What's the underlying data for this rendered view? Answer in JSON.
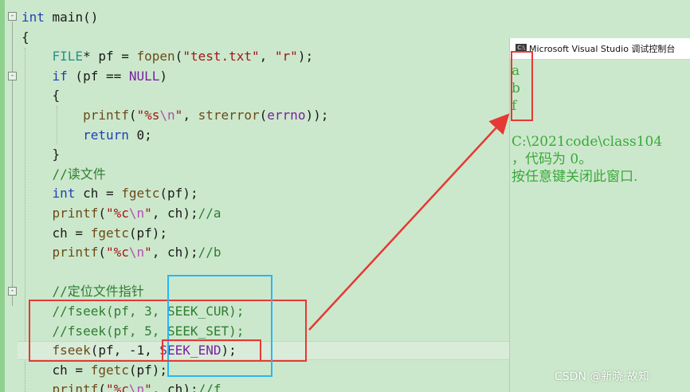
{
  "code_lines": [
    [
      {
        "t": "int",
        "c": "kw"
      },
      {
        "t": " main()"
      }
    ],
    [
      {
        "t": "{"
      }
    ],
    [
      {
        "t": "    "
      },
      {
        "t": "FILE",
        "c": "ty"
      },
      {
        "t": "* pf = "
      },
      {
        "t": "fopen",
        "c": "fn"
      },
      {
        "t": "("
      },
      {
        "t": "\"test.txt\"",
        "c": "str"
      },
      {
        "t": ", "
      },
      {
        "t": "\"r\"",
        "c": "str"
      },
      {
        "t": ");"
      }
    ],
    [
      {
        "t": "    "
      },
      {
        "t": "if",
        "c": "kw"
      },
      {
        "t": " (pf == "
      },
      {
        "t": "NULL",
        "c": "mac"
      },
      {
        "t": ")"
      }
    ],
    [
      {
        "t": "    {"
      }
    ],
    [
      {
        "t": "        "
      },
      {
        "t": "printf",
        "c": "fn"
      },
      {
        "t": "("
      },
      {
        "t": "\"%s",
        "c": "str"
      },
      {
        "t": "\\n",
        "c": "esc"
      },
      {
        "t": "\"",
        "c": "str"
      },
      {
        "t": ", "
      },
      {
        "t": "strerror",
        "c": "fn"
      },
      {
        "t": "("
      },
      {
        "t": "errno",
        "c": "mac"
      },
      {
        "t": "));"
      }
    ],
    [
      {
        "t": "        "
      },
      {
        "t": "return",
        "c": "kw"
      },
      {
        "t": " 0;"
      }
    ],
    [
      {
        "t": "    }"
      }
    ],
    [
      {
        "t": "    "
      },
      {
        "t": "//读文件",
        "c": "cm"
      }
    ],
    [
      {
        "t": "    "
      },
      {
        "t": "int",
        "c": "kw"
      },
      {
        "t": " ch = "
      },
      {
        "t": "fgetc",
        "c": "fn"
      },
      {
        "t": "(pf);"
      }
    ],
    [
      {
        "t": "    "
      },
      {
        "t": "printf",
        "c": "fn"
      },
      {
        "t": "("
      },
      {
        "t": "\"%c",
        "c": "str"
      },
      {
        "t": "\\n",
        "c": "esc"
      },
      {
        "t": "\"",
        "c": "str"
      },
      {
        "t": ", ch);"
      },
      {
        "t": "//a",
        "c": "cm"
      }
    ],
    [
      {
        "t": "    ch = "
      },
      {
        "t": "fgetc",
        "c": "fn"
      },
      {
        "t": "(pf);"
      }
    ],
    [
      {
        "t": "    "
      },
      {
        "t": "printf",
        "c": "fn"
      },
      {
        "t": "("
      },
      {
        "t": "\"%c",
        "c": "str"
      },
      {
        "t": "\\n",
        "c": "esc"
      },
      {
        "t": "\"",
        "c": "str"
      },
      {
        "t": ", ch);"
      },
      {
        "t": "//b",
        "c": "cm"
      }
    ],
    [
      {
        "t": ""
      }
    ],
    [
      {
        "t": "    "
      },
      {
        "t": "//定位文件指针",
        "c": "cm"
      }
    ],
    [
      {
        "t": "    "
      },
      {
        "t": "//fseek(pf, 3, SEEK_CUR);",
        "c": "cm"
      }
    ],
    [
      {
        "t": "    "
      },
      {
        "t": "//fseek(pf, 5, SEEK_SET);",
        "c": "cm"
      }
    ],
    [
      {
        "t": "    "
      },
      {
        "t": "fseek",
        "c": "fn"
      },
      {
        "t": "(pf, -1, "
      },
      {
        "t": "SEEK_END",
        "c": "mac"
      },
      {
        "t": ");"
      }
    ],
    [
      {
        "t": "    ch = "
      },
      {
        "t": "fgetc",
        "c": "fn"
      },
      {
        "t": "(pf);"
      }
    ],
    [
      {
        "t": "    "
      },
      {
        "t": "printf",
        "c": "fn"
      },
      {
        "t": "("
      },
      {
        "t": "\"%c",
        "c": "str"
      },
      {
        "t": "\\n",
        "c": "esc"
      },
      {
        "t": "\"",
        "c": "str"
      },
      {
        "t": ", ch);"
      },
      {
        "t": "//f",
        "c": "cm"
      }
    ]
  ],
  "fold_markers": [
    "-",
    "-",
    "-"
  ],
  "console": {
    "icon_text": "C:\\",
    "title": "Microsoft Visual Studio 调试控制台",
    "output": [
      "a",
      "b",
      "f"
    ],
    "path_line": "C:\\2021code\\class104",
    "exit_line": "，代码为 0。",
    "close_line": "按任意键关闭此窗口."
  },
  "watermark": "CSDN @新晓·故知",
  "colors": {
    "editor_bg": "#cce8cc",
    "annotation_red": "#e53935",
    "annotation_blue": "#29b6f6",
    "console_text": "#3aa83a"
  }
}
